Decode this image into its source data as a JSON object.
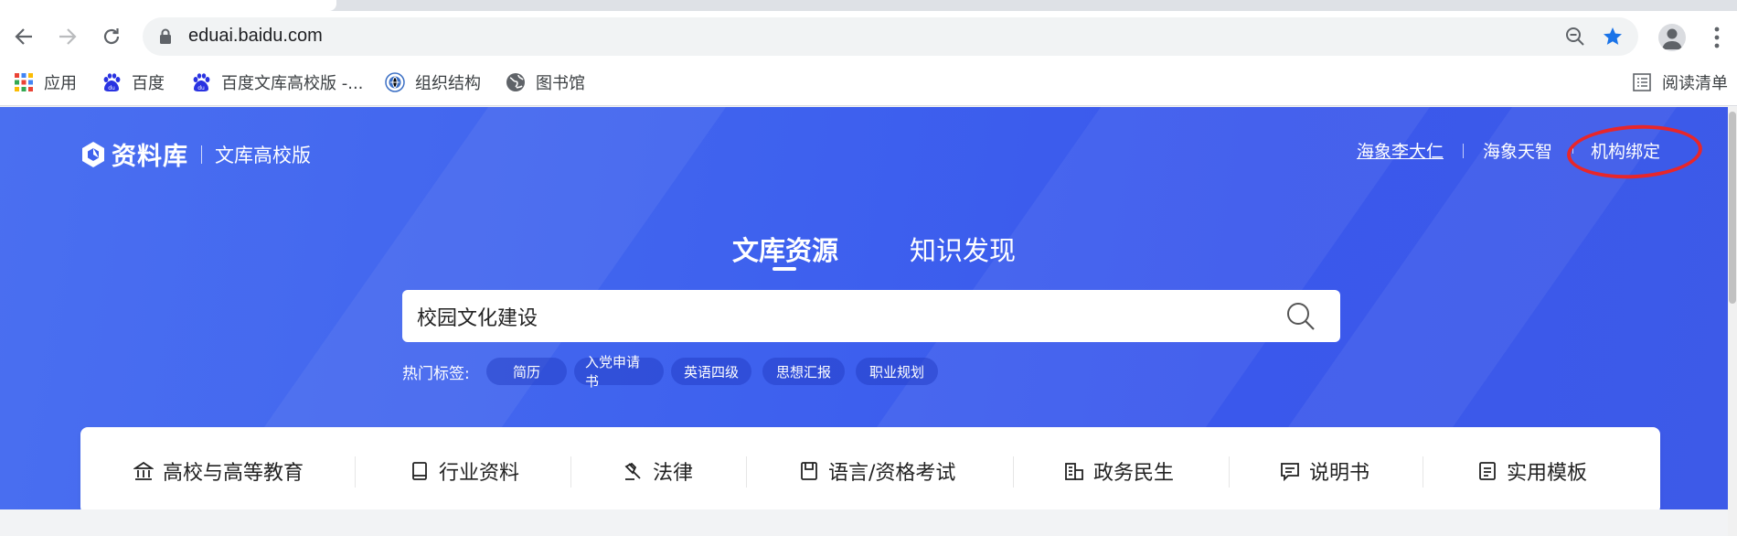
{
  "browser": {
    "url": "eduai.baidu.com",
    "bookmarks": [
      {
        "label": "应用",
        "icon": "apps-grid-icon"
      },
      {
        "label": "百度",
        "icon": "baidu-paw-icon"
      },
      {
        "label": "百度文库高校版 -...",
        "icon": "baidu-paw-icon"
      },
      {
        "label": "组织结构",
        "icon": "globe-logo-icon"
      },
      {
        "label": "图书馆",
        "icon": "globe-icon"
      }
    ],
    "reading_list": "阅读清单"
  },
  "header": {
    "brand": "资料库",
    "product": "文库高校版",
    "user_links": [
      "海象李大仁",
      "海象天智",
      "机构绑定"
    ]
  },
  "tabs": [
    {
      "label": "文库资源",
      "active": true
    },
    {
      "label": "知识发现",
      "active": false
    }
  ],
  "search": {
    "value": "校园文化建设",
    "hot_label": "热门标签:",
    "hot_tags": [
      "简历",
      "入党申请书",
      "英语四级",
      "思想汇报",
      "职业规划"
    ]
  },
  "categories": [
    "高校与高等教育",
    "行业资料",
    "法律",
    "语言/资格考试",
    "政务民生",
    "说明书",
    "实用模板"
  ],
  "colors": {
    "hero_blue": "#3e61ee",
    "highlight_red": "#e8262a",
    "star_blue": "#1a73e8"
  }
}
